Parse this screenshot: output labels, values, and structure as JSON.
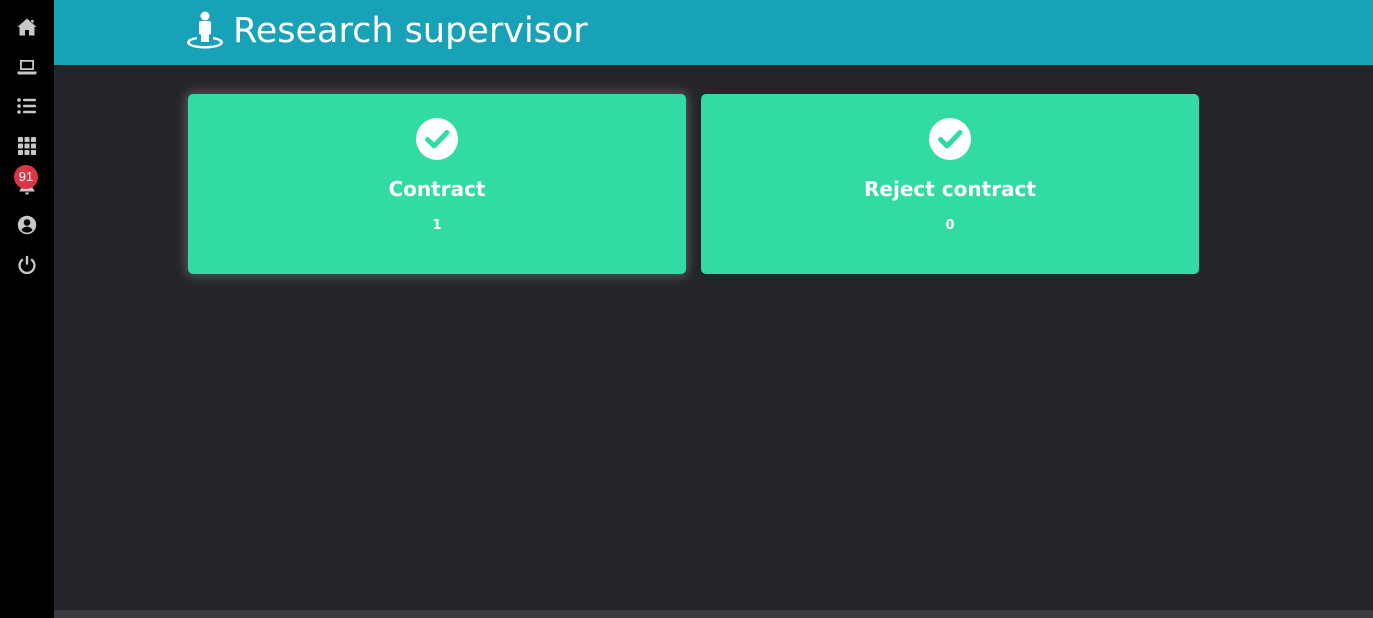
{
  "header": {
    "title": "Research supervisor",
    "icon": "user-standing-icon",
    "background": "#17a2b8"
  },
  "sidebar": {
    "items": [
      {
        "name": "home",
        "icon": "home-icon"
      },
      {
        "name": "laptop",
        "icon": "laptop-icon"
      },
      {
        "name": "list",
        "icon": "list-icon"
      },
      {
        "name": "apps",
        "icon": "grid-icon"
      },
      {
        "name": "notifications",
        "icon": "bell-icon"
      },
      {
        "name": "profile",
        "icon": "user-circle-icon"
      },
      {
        "name": "logout",
        "icon": "power-icon"
      }
    ],
    "notification_count": "91"
  },
  "cards": [
    {
      "title": "Contract",
      "count": "1",
      "icon": "check-circle-icon"
    },
    {
      "title": "Reject contract",
      "count": "0",
      "icon": "check-circle-icon"
    }
  ],
  "colors": {
    "card": "#33dba4",
    "page_bg": "#23252a",
    "badge": "#dc3545"
  }
}
